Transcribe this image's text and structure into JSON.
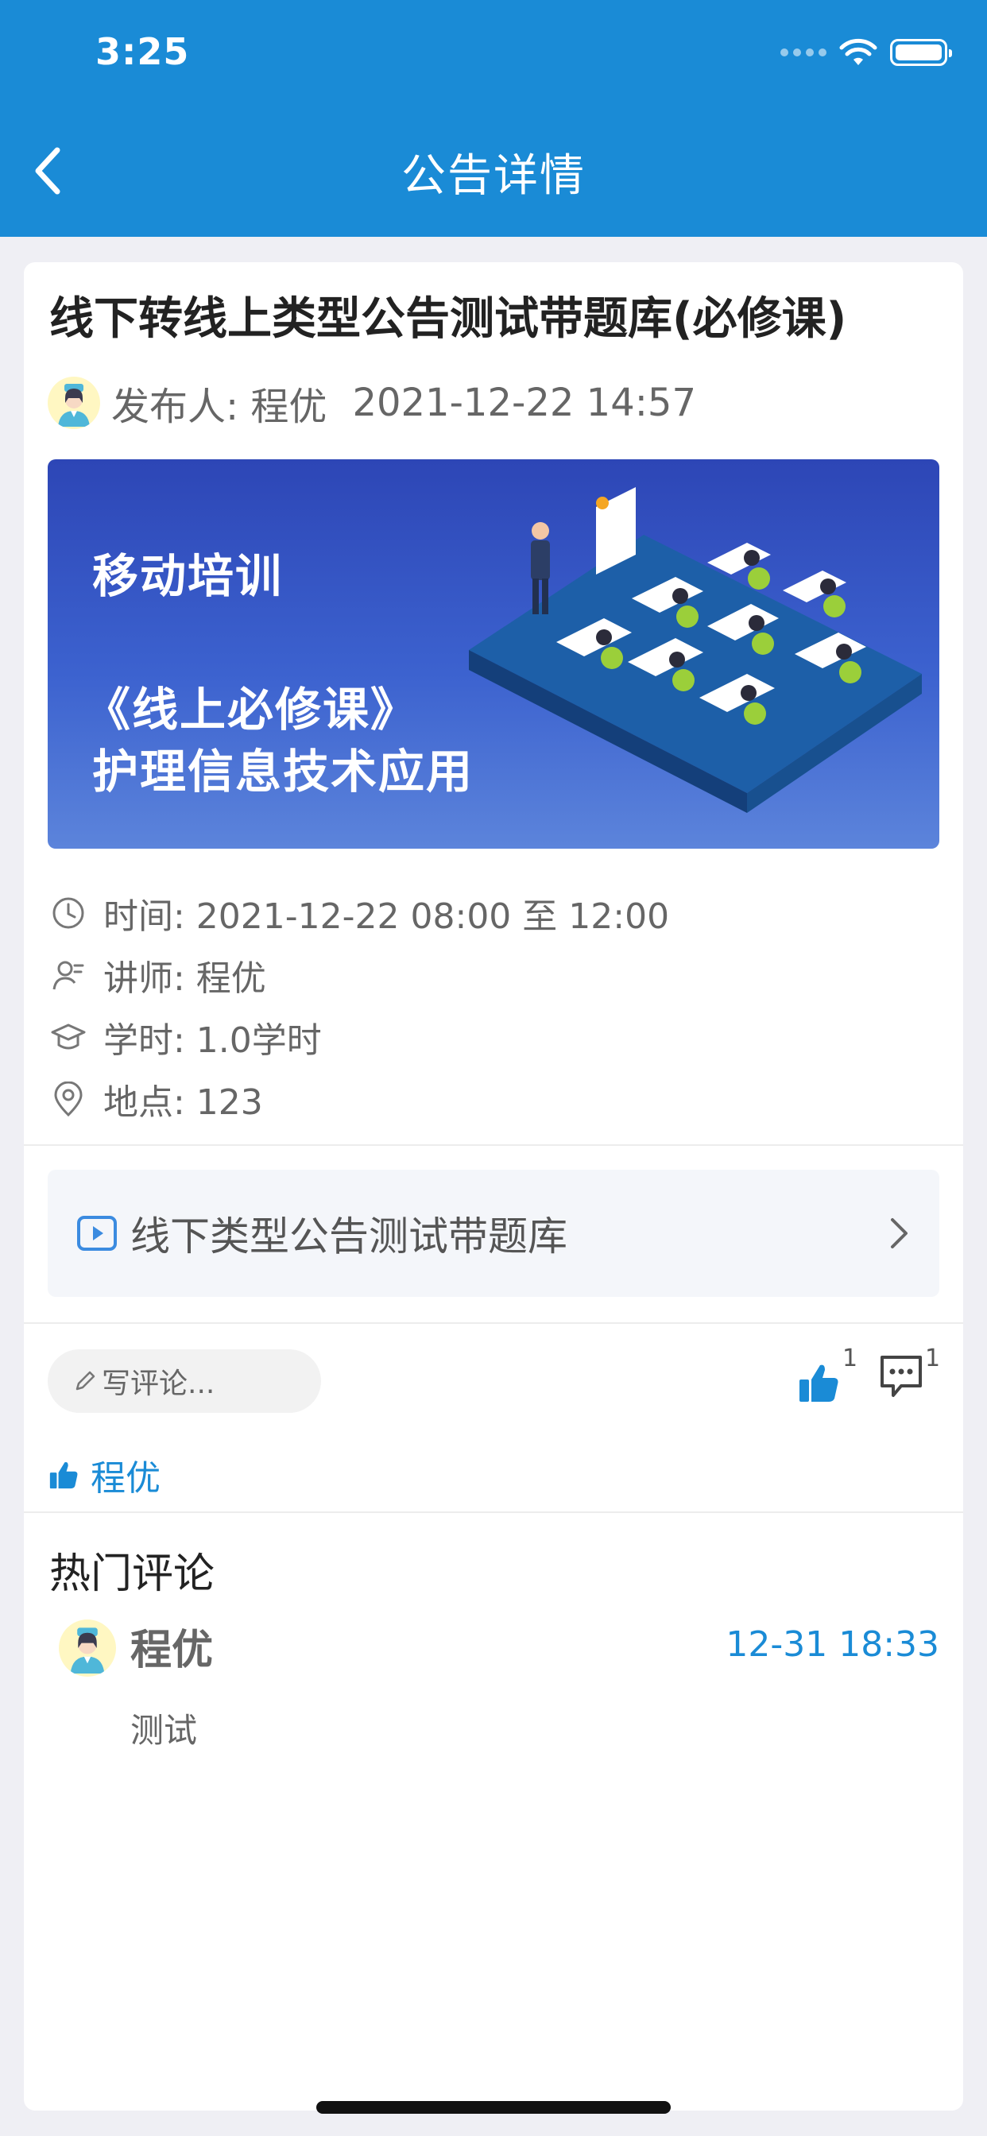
{
  "status_bar": {
    "time": "3:25"
  },
  "nav": {
    "title": "公告详情"
  },
  "notice": {
    "title": "线下转线上类型公告测试带题库(必修课)",
    "publisher_label": "发布人: 程优",
    "publish_datetime": "2021-12-22 14:57"
  },
  "banner": {
    "line1": "移动培训",
    "line2": "《线上必修课》",
    "line3": "护理信息技术应用"
  },
  "info": {
    "time": "时间:  2021-12-22 08:00 至 12:00",
    "lecturer": "讲师:  程优",
    "hours": "学时:  1.0学时",
    "location": "地点:  123"
  },
  "lesson": {
    "label": "线下类型公告测试带题库"
  },
  "actions": {
    "comment_placeholder": "写评论...",
    "like_count": "1",
    "comment_count": "1"
  },
  "likers": {
    "name": "程优"
  },
  "hot_comments": {
    "title": "热门评论",
    "items": [
      {
        "name": "程优",
        "time": "12-31 18:33",
        "text": "测试"
      }
    ]
  },
  "colors": {
    "brand": "#1a8bd6",
    "background": "#efeff4"
  }
}
